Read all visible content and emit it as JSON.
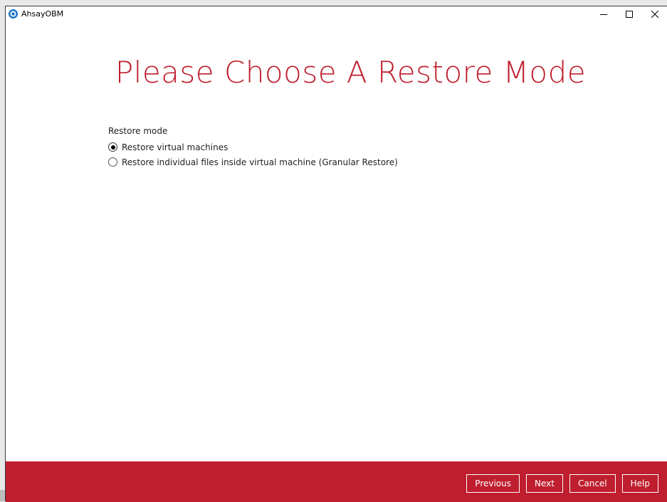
{
  "window": {
    "title": "AhsayOBM",
    "icon": "ahsay-logo-icon",
    "controls": [
      "minimize-icon",
      "maximize-icon",
      "close-icon"
    ]
  },
  "page": {
    "heading": "Please Choose A Restore Mode"
  },
  "restore_mode": {
    "label": "Restore mode",
    "options": [
      {
        "label": "Restore virtual machines",
        "selected": true
      },
      {
        "label": "Restore individual files inside virtual machine (Granular Restore)",
        "selected": false
      }
    ]
  },
  "footer": {
    "previous": "Previous",
    "next": "Next",
    "cancel": "Cancel",
    "help": "Help"
  },
  "colors": {
    "accent": "#bf1e2e",
    "app_icon": "#1a73c8"
  }
}
